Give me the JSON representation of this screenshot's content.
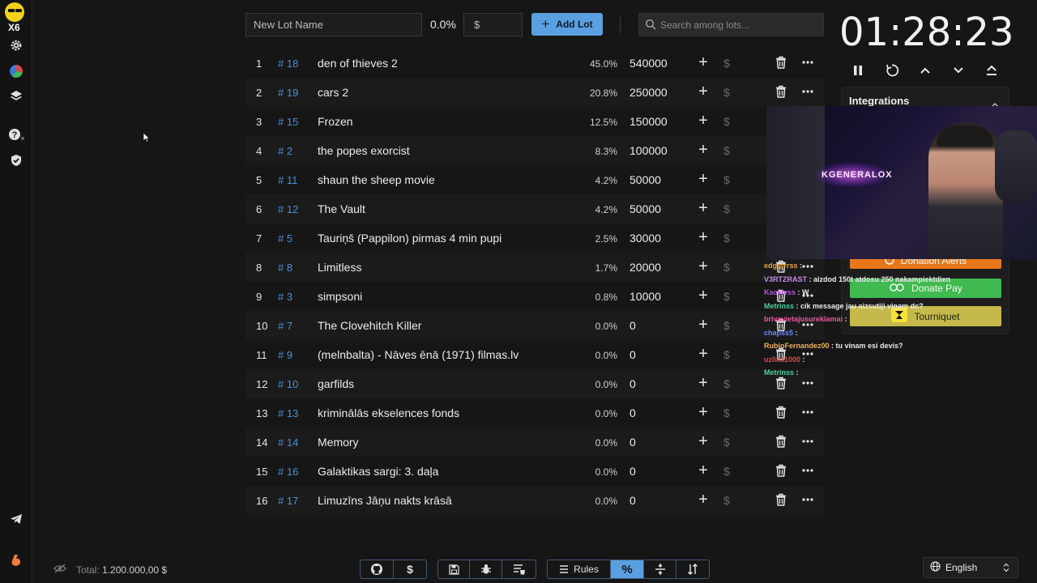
{
  "app": {
    "logo_multiplier": "X6"
  },
  "sidebar": {
    "items": [
      {
        "name": "settings-icon"
      },
      {
        "name": "stats-pie-icon"
      },
      {
        "name": "layers-icon"
      },
      {
        "name": "help-icon"
      },
      {
        "name": "shield-check-icon"
      },
      {
        "name": "telegram-icon"
      },
      {
        "name": "boosty-icon"
      }
    ]
  },
  "toolbar": {
    "lot_name_placeholder": "New Lot Name",
    "percent_label": "0.0%",
    "amount_placeholder": "$",
    "add_lot_label": "Add Lot",
    "search_placeholder": "Search among lots..."
  },
  "lots": [
    {
      "n": "1",
      "id": "# 18",
      "name": "den of thieves 2",
      "pct": "45.0%",
      "amount": "540000"
    },
    {
      "n": "2",
      "id": "# 19",
      "name": "cars 2",
      "pct": "20.8%",
      "amount": "250000"
    },
    {
      "n": "3",
      "id": "# 15",
      "name": "Frozen",
      "pct": "12.5%",
      "amount": "150000"
    },
    {
      "n": "4",
      "id": "# 2",
      "name": "the popes exorcist",
      "pct": "8.3%",
      "amount": "100000"
    },
    {
      "n": "5",
      "id": "# 11",
      "name": "shaun the sheep movie",
      "pct": "4.2%",
      "amount": "50000"
    },
    {
      "n": "6",
      "id": "# 12",
      "name": "The Vault",
      "pct": "4.2%",
      "amount": "50000"
    },
    {
      "n": "7",
      "id": "# 5",
      "name": "Tauriņš (Pappilon) pirmas 4 min pupi",
      "pct": "2.5%",
      "amount": "30000"
    },
    {
      "n": "8",
      "id": "# 8",
      "name": "Limitless",
      "pct": "1.7%",
      "amount": "20000"
    },
    {
      "n": "9",
      "id": "# 3",
      "name": "simpsoni",
      "pct": "0.8%",
      "amount": "10000"
    },
    {
      "n": "10",
      "id": "# 7",
      "name": "The Clovehitch Killer",
      "pct": "0.0%",
      "amount": "0"
    },
    {
      "n": "11",
      "id": "# 9",
      "name": "(melnbalta) - Nāves ēnā (1971) filmas.lv",
      "pct": "0.0%",
      "amount": "0"
    },
    {
      "n": "12",
      "id": "# 10",
      "name": "garfilds",
      "pct": "0.0%",
      "amount": "0"
    },
    {
      "n": "13",
      "id": "# 13",
      "name": "kriminālās ekselences fonds",
      "pct": "0.0%",
      "amount": "0"
    },
    {
      "n": "14",
      "id": "# 14",
      "name": "Memory",
      "pct": "0.0%",
      "amount": "0"
    },
    {
      "n": "15",
      "id": "# 16",
      "name": "Galaktikas sargi: 3. daļa",
      "pct": "0.0%",
      "amount": "0"
    },
    {
      "n": "16",
      "id": "# 17",
      "name": "Limuzīns Jāņu nakts krāsā",
      "pct": "0.0%",
      "amount": "0"
    }
  ],
  "row_actions": {
    "add_symbol": "+",
    "donate_symbol": "$"
  },
  "timer": {
    "display": "01:28:23"
  },
  "integrations": {
    "title": "Integrations",
    "buttons": [
      {
        "label": "Donation Alerts"
      },
      {
        "label": "Donate Pay"
      },
      {
        "label": "Tourniquet"
      }
    ]
  },
  "webcam": {
    "neon_sign": "KGENERALOX"
  },
  "chat": [
    {
      "user": "edgarrrss",
      "msg": "",
      "color": "#e8a33d"
    },
    {
      "user": "V3RTZRAST",
      "msg": "aizdod 150t atdosu 250 nakampiektdien",
      "color": "#c08ce8"
    },
    {
      "user": "Kacklvss",
      "msg": "W",
      "color": "#b455d8"
    },
    {
      "user": "Metrinss",
      "msg": "cik message jau aizsutiji vinam dc?",
      "color": "#4ad29b"
    },
    {
      "user": "brivavietajusureklamai",
      "msg": "",
      "color": "#e85aa0"
    },
    {
      "user": "chapss5",
      "msg": "",
      "color": "#6f86ff"
    },
    {
      "user": "RubioFernandez00",
      "msg": "tu vinam esi devis?",
      "color": "#f0b15c"
    },
    {
      "user": "uzlika1000",
      "msg": "",
      "color": "#d94a4a"
    },
    {
      "user": "Metrinss",
      "msg": "",
      "color": "#4ad29b"
    }
  ],
  "footer": {
    "total_label": "Total:",
    "total_value": "1.200.000,00 $",
    "rules_label": "Rules",
    "language": "English"
  },
  "colors": {
    "accent": "#5a9fe0",
    "lot_id": "#4a90d9",
    "background": "#161616",
    "donation_alerts": "#e8771a",
    "donate_pay": "#3fb950",
    "tourniquet": "#c4b94a"
  }
}
